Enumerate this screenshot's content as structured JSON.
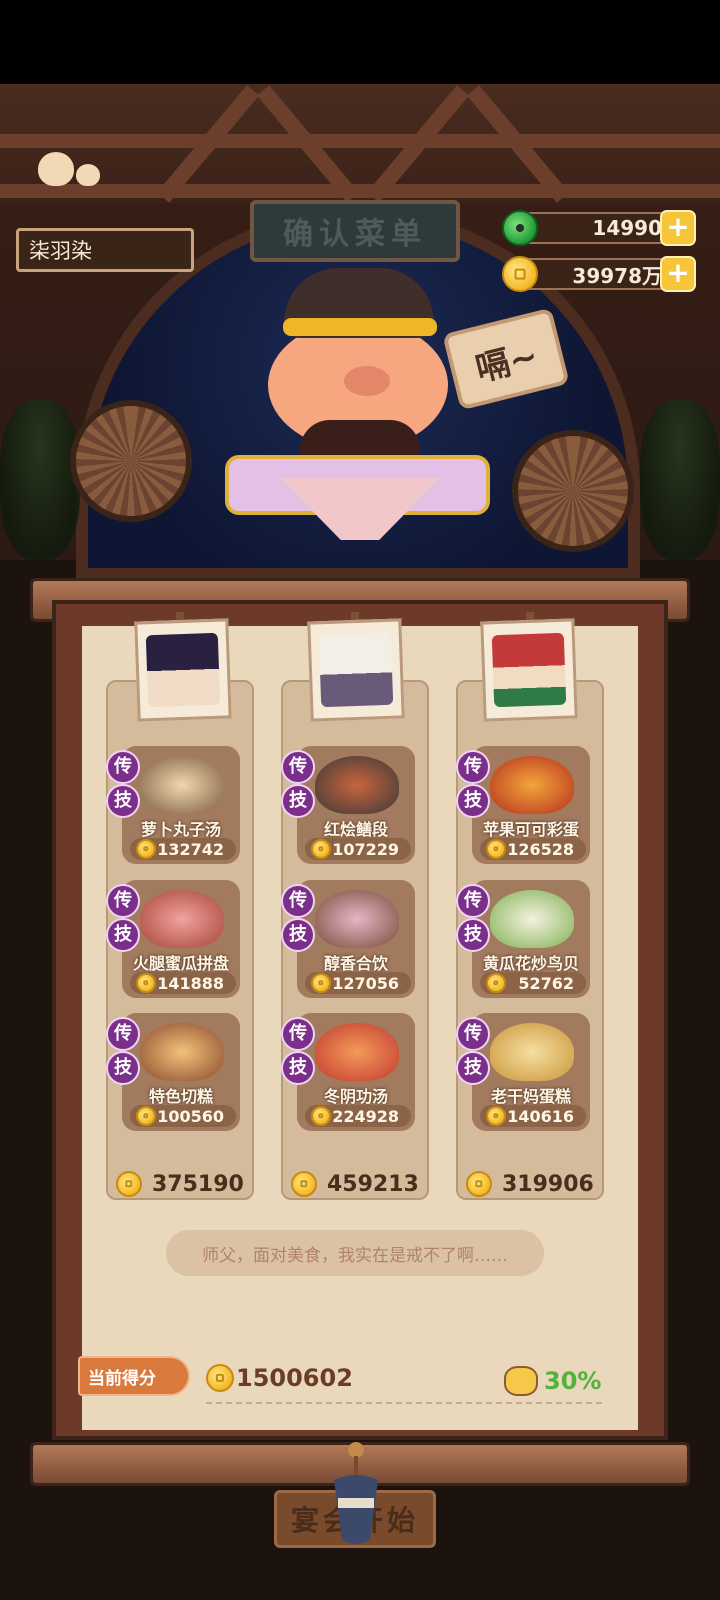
{
  "header": {
    "sign_title": "确认菜单",
    "player_name": "柒羽染",
    "jade_amount": "14990",
    "coin_amount": "39978万",
    "plus_label": "+"
  },
  "character": {
    "speech_tag": "嗝~"
  },
  "columns": [
    {
      "total": "375190",
      "dishes": [
        {
          "name": "萝卜丸子汤",
          "value": "132742",
          "badge_top": "传",
          "badge_bottom": "技"
        },
        {
          "name": "火腿蜜瓜拼盘",
          "value": "141888",
          "badge_top": "传",
          "badge_bottom": "技"
        },
        {
          "name": "特色切糕",
          "value": "100560",
          "badge_top": "传",
          "badge_bottom": "技"
        }
      ]
    },
    {
      "total": "459213",
      "dishes": [
        {
          "name": "红烩鳝段",
          "value": "107229",
          "badge_top": "传",
          "badge_bottom": "技"
        },
        {
          "name": "醇香合饮",
          "value": "127056",
          "badge_top": "传",
          "badge_bottom": "技"
        },
        {
          "name": "冬阴功汤",
          "value": "224928",
          "badge_top": "传",
          "badge_bottom": "技"
        }
      ]
    },
    {
      "total": "319906",
      "dishes": [
        {
          "name": "苹果可可彩蛋",
          "value": "126528",
          "badge_top": "传",
          "badge_bottom": "技"
        },
        {
          "name": "黄瓜花炒鸟贝",
          "value": "52762",
          "badge_top": "传",
          "badge_bottom": "技"
        },
        {
          "name": "老干妈蛋糕",
          "value": "140616",
          "badge_top": "传",
          "badge_bottom": "技"
        }
      ]
    }
  ],
  "quote": "师父，面对美食，我实在是戒不了啊……",
  "score": {
    "label": "当前得分",
    "value": "1500602",
    "bonus": "30%"
  },
  "start_button": "宴会开始",
  "colors": {
    "accent_gold": "#f2b824",
    "bonus_green": "#52b33a",
    "badge_purple": "#7b2f8a",
    "paper": "#ead8bd"
  },
  "icons": [
    "jade-icon",
    "coin-icon",
    "plus-icon",
    "pig-bonus-icon"
  ]
}
